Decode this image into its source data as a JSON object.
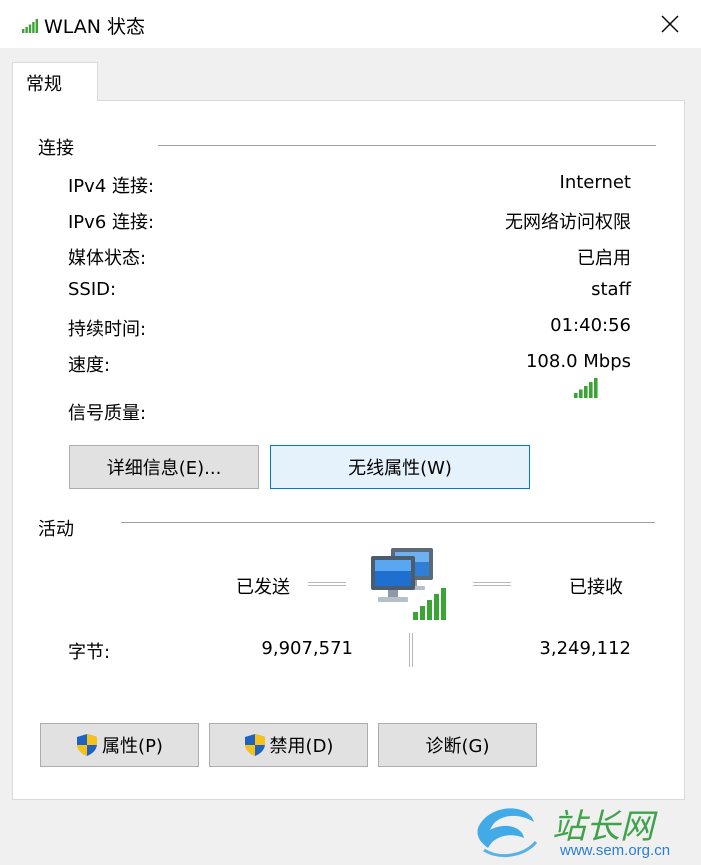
{
  "window": {
    "title": "WLAN 状态",
    "close_glyph": "✕"
  },
  "tab": {
    "label": "常规"
  },
  "connection": {
    "section_title": "连接",
    "rows": [
      {
        "label": "IPv4 连接:",
        "value": "Internet"
      },
      {
        "label": "IPv6 连接:",
        "value": "无网络访问权限"
      },
      {
        "label": "媒体状态:",
        "value": "已启用"
      },
      {
        "label": "SSID:",
        "value": "staff"
      },
      {
        "label": "持续时间:",
        "value": "01:40:56"
      },
      {
        "label": "速度:",
        "value": "108.0 Mbps"
      }
    ],
    "signal_label": "信号质量:",
    "signal_bars": 5,
    "details_button": "详细信息(E)...",
    "wireless_button": "无线属性(W)"
  },
  "activity": {
    "section_title": "活动",
    "sent_label": "已发送",
    "received_label": "已接收",
    "bytes_label": "字节:",
    "bytes_sent": "9,907,571",
    "bytes_received": "3,249,112"
  },
  "buttons": {
    "properties": "属性(P)",
    "disable": "禁用(D)",
    "diagnose": "诊断(G)"
  },
  "watermark": {
    "url": "www.sem.org.cn"
  },
  "colors": {
    "signal_green": "#3aa535",
    "focus_blue": "#0078d7",
    "shield_blue": "#1e63c3",
    "shield_yellow": "#f7c218"
  }
}
